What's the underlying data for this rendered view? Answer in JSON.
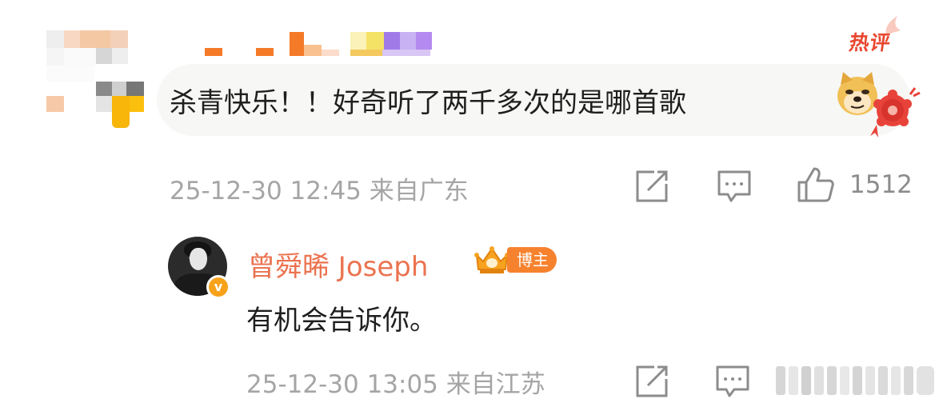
{
  "hot_badge": "热评",
  "comment": {
    "text": "杀青快乐！！好奇听了两千多次的是哪首歌",
    "timestamp": "25-12-30 12:45",
    "location": "来自广东",
    "like_count": "1512"
  },
  "reply": {
    "author": "曾舜晞 Joseph",
    "author_badge": "博主",
    "verified_mark": "v",
    "text": "有机会告诉你。",
    "timestamp": "25-12-30 13:05",
    "location": "来自江苏"
  },
  "icons": [
    "share-icon",
    "comment-icon",
    "thumbs-up-icon",
    "doge-emoji-icon",
    "flower-emoji-icon",
    "crown-icon"
  ],
  "colors": {
    "author_name": "#eb7350",
    "hot_badge": "#e8472f",
    "owner_badge": "#f7822e",
    "meta": "#a5a5a5"
  }
}
